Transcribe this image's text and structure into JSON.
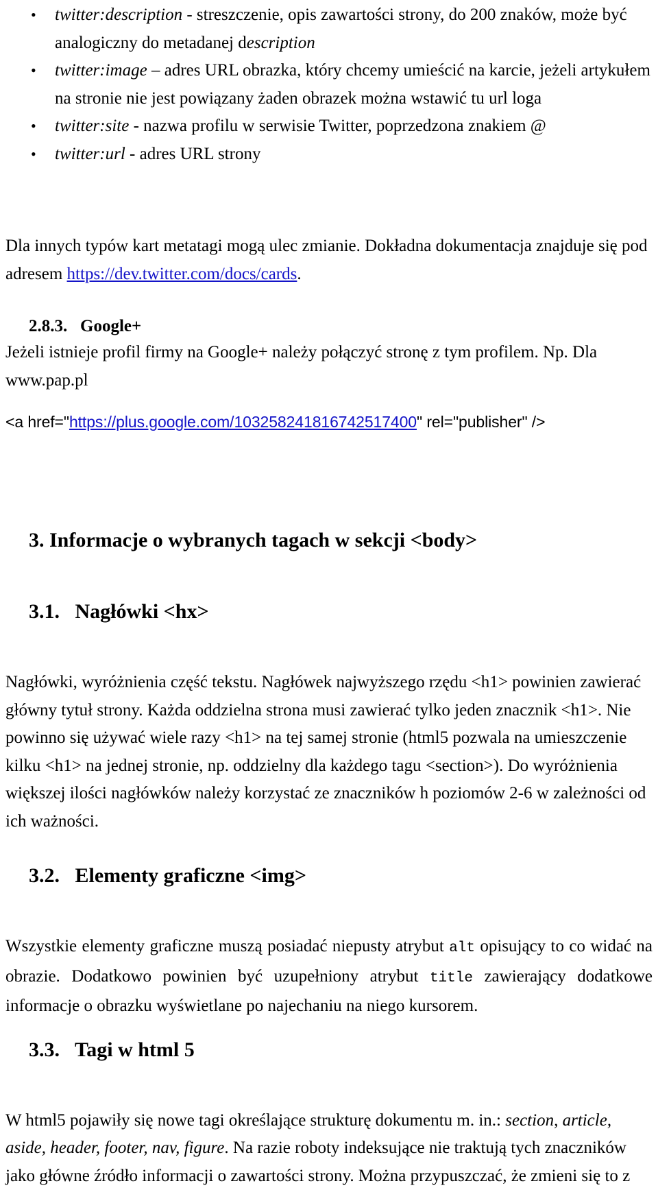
{
  "document": {
    "language": "pl",
    "link_color": "#1414c8",
    "text_color": "#000000",
    "background_color": "#ffffff"
  },
  "bullets": [
    {
      "term": "twitter:description",
      "rest": " -  streszczenie, opis zawartości strony, do 200 znaków, może być analogiczny do metadanej d",
      "tail_italic": "escription"
    },
    {
      "term": "twitter:image",
      "rest": " – adres URL obrazka, który chcemy umieścić na karcie, jeżeli artykułem na stronie nie jest powiązany żaden obrazek można wstawić tu url loga",
      "tail_italic": ""
    },
    {
      "term": "twitter:site",
      "rest": " - nazwa profilu w serwisie Twitter, poprzedzona znakiem @",
      "tail_italic": ""
    },
    {
      "term": "twitter:url",
      "rest": " - adres URL strony",
      "tail_italic": ""
    }
  ],
  "cards_paragraph": {
    "before_link": "Dla innych typów kart metatagi mogą ulec zmianie. Dokładna dokumentacja znajduje się pod adresem ",
    "link_text": "https://dev.twitter.com/docs/cards",
    "after_link": "."
  },
  "section_283": {
    "number": "2.8.3.",
    "title": "Google+",
    "paragraph": "Jeżeli istnieje profil firmy na Google+ należy połączyć stronę z tym profilem. Np. Dla www.pap.pl",
    "code": {
      "prefix": "<a href=\"",
      "link_text": "https://plus.google.com/103258241816742517400",
      "suffix": "\" rel=\"publisher\" />"
    }
  },
  "section_3": {
    "number": "3.",
    "title": "Informacje o wybranych tagach w sekcji <body>"
  },
  "section_31": {
    "number": "3.1.",
    "title": "Nagłówki <hx>",
    "paragraph": "Nagłówki, wyróżnienia część tekstu. Nagłówek najwyższego rzędu <h1>  powinien zawierać główny tytuł strony. Każda oddzielna strona musi zawierać tylko jeden znacznik <h1>. Nie powinno się używać wiele razy <h1> na tej samej stronie (html5 pozwala na umieszczenie kilku <h1> na jednej stronie, np. oddzielny dla każdego tagu <section>). Do wyróżnienia większej ilości nagłówków  należy korzystać ze znaczników h poziomów 2-6 w zależności od ich ważności."
  },
  "section_32": {
    "number": "3.2.",
    "title": "Elementy graficzne <img>",
    "p_part1": "Wszystkie elementy graficzne muszą posiadać niepusty atrybut ",
    "code_alt": "alt",
    "p_part2": " opisujący to co widać na obrazie. Dodatkowo powinien być uzupełniony atrybut ",
    "code_title": "title",
    "p_part3": " zawierający dodatkowe informacje o obrazku wyświetlane po najechaniu na niego kursorem."
  },
  "section_33": {
    "number": "3.3.",
    "title": "Tagi w html 5",
    "p_part1": "W html5 pojawiły się nowe tagi określające strukturę dokumentu m. in.: ",
    "tags_italic": "section, article, aside, header, footer, nav, figure",
    "p_part2": ". Na razie roboty indeksujące nie traktują tych znaczników jako główne źródło informacji o zawartości strony. Można przypuszczać, że zmieni się to z"
  }
}
